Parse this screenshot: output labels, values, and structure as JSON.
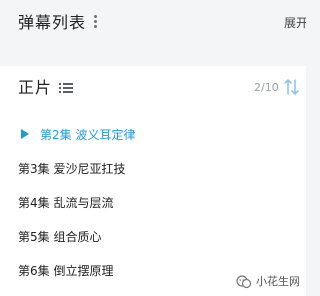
{
  "danmaku": {
    "title": "弹幕列表",
    "expand_label": "展开"
  },
  "playlist": {
    "title": "正片",
    "progress": "2/10",
    "episodes": [
      {
        "label": "第2集 波义耳定律",
        "active": true
      },
      {
        "label": "第3集 爱沙尼亚扛技",
        "active": false
      },
      {
        "label": "第4集 乱流与层流",
        "active": false
      },
      {
        "label": "第5集 组合质心",
        "active": false
      },
      {
        "label": "第6集 倒立摆原理",
        "active": false
      }
    ]
  },
  "watermark": {
    "text": "小花生网"
  },
  "icons": {
    "more": "kebab-menu-icon",
    "list": "list-view-icon",
    "sort": "sort-order-icon",
    "play": "play-icon",
    "wechat": "wechat-icon"
  },
  "colors": {
    "accent": "#1e9ad6",
    "text": "#222222",
    "muted": "#9a9fa7",
    "background": "#f4f5f7",
    "panel": "#ffffff"
  }
}
